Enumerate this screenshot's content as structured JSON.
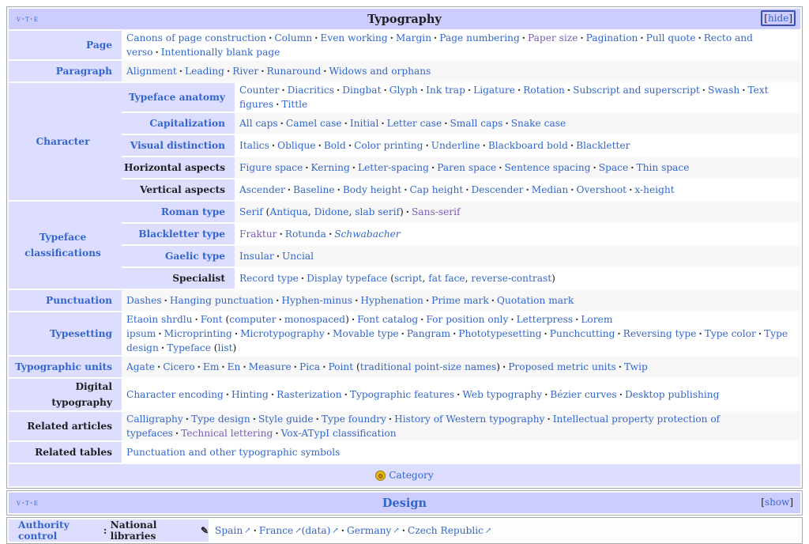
{
  "vte": [
    "v",
    "t",
    "e"
  ],
  "typography": {
    "title": "Typography",
    "toggle": "hide",
    "groups": [
      {
        "id": "page",
        "label": "Page",
        "label_link": true,
        "rowspan": 1,
        "items": [
          {
            "t": "Canons of page construction"
          },
          {
            "t": "Column"
          },
          {
            "t": "Even working"
          },
          {
            "t": "Margin"
          },
          {
            "t": "Page numbering"
          },
          {
            "t": "Paper size",
            "visited": true
          },
          {
            "t": "Pagination"
          },
          {
            "t": "Pull quote"
          },
          {
            "t": "Recto and verso"
          },
          {
            "t": "Intentionally blank page"
          }
        ]
      },
      {
        "id": "paragraph",
        "label": "Paragraph",
        "label_link": true,
        "items": [
          {
            "t": "Alignment"
          },
          {
            "t": "Leading"
          },
          {
            "t": "River"
          },
          {
            "t": "Runaround"
          },
          {
            "t": "Widows and orphans"
          }
        ]
      },
      {
        "id": "character",
        "label": "Character",
        "label_link": true,
        "subgroups": [
          {
            "label": "Typeface anatomy",
            "label_link": true,
            "items": [
              {
                "t": "Counter"
              },
              {
                "t": "Diacritics"
              },
              {
                "t": "Dingbat"
              },
              {
                "t": "Glyph"
              },
              {
                "t": "Ink trap"
              },
              {
                "t": "Ligature"
              },
              {
                "t": "Rotation"
              },
              {
                "t": "Subscript and superscript"
              },
              {
                "t": "Swash"
              },
              {
                "t": "Text figures"
              },
              {
                "t": "Tittle"
              }
            ]
          },
          {
            "label": "Capitalization",
            "label_link": true,
            "items": [
              {
                "t": "All caps"
              },
              {
                "t": "Camel case"
              },
              {
                "t": "Initial"
              },
              {
                "t": "Letter case"
              },
              {
                "t": "Small caps"
              },
              {
                "t": "Snake case"
              }
            ]
          },
          {
            "label": "Visual distinction",
            "label_link": true,
            "items": [
              {
                "t": "Italics"
              },
              {
                "t": "Oblique"
              },
              {
                "t": "Bold"
              },
              {
                "t": "Color printing"
              },
              {
                "t": "Underline"
              },
              {
                "t": "Blackboard bold"
              },
              {
                "t": "Blackletter"
              }
            ]
          },
          {
            "label": "Horizontal aspects",
            "label_link": false,
            "items": [
              {
                "t": "Figure space"
              },
              {
                "t": "Kerning"
              },
              {
                "t": "Letter-spacing"
              },
              {
                "t": "Paren space"
              },
              {
                "t": "Sentence spacing"
              },
              {
                "t": "Space"
              },
              {
                "t": "Thin space"
              }
            ]
          },
          {
            "label": "Vertical aspects",
            "label_link": false,
            "items": [
              {
                "t": "Ascender"
              },
              {
                "t": "Baseline"
              },
              {
                "t": "Body height"
              },
              {
                "t": "Cap height"
              },
              {
                "t": "Descender"
              },
              {
                "t": "Median"
              },
              {
                "t": "Overshoot"
              },
              {
                "t": "x-height"
              }
            ]
          }
        ]
      },
      {
        "id": "classifications",
        "label": "Typeface classifications",
        "label_link": true,
        "subgroups": [
          {
            "label": "Roman type",
            "label_link": true,
            "rich": [
              {
                "t": "Serif"
              },
              {
                "p": " ("
              },
              {
                "t": "Antiqua"
              },
              {
                "p": ", "
              },
              {
                "t": "Didone"
              },
              {
                "p": ", "
              },
              {
                "t": "slab serif"
              },
              {
                "p": ")"
              },
              {
                "s": 1
              },
              {
                "t": "Sans-serif",
                "visited": true
              }
            ]
          },
          {
            "label": "Blackletter type",
            "label_link": true,
            "rich": [
              {
                "t": "Fraktur",
                "visited": true
              },
              {
                "s": 1
              },
              {
                "t": "Rotunda"
              },
              {
                "s": 1
              },
              {
                "t": "Schwabacher",
                "italic": true
              }
            ]
          },
          {
            "label": "Gaelic type",
            "label_link": true,
            "rich": [
              {
                "t": "Insular"
              },
              {
                "s": 1
              },
              {
                "t": "Uncial"
              }
            ]
          },
          {
            "label": "Specialist",
            "label_link": false,
            "rich": [
              {
                "t": "Record type"
              },
              {
                "s": 1
              },
              {
                "t": "Display typeface"
              },
              {
                "p": " ("
              },
              {
                "t": "script"
              },
              {
                "p": ", "
              },
              {
                "t": "fat face"
              },
              {
                "p": ", "
              },
              {
                "t": "reverse-contrast"
              },
              {
                "p": ")"
              }
            ]
          }
        ]
      },
      {
        "id": "punctuation",
        "label": "Punctuation",
        "label_link": true,
        "items": [
          {
            "t": "Dashes"
          },
          {
            "t": "Hanging punctuation"
          },
          {
            "t": "Hyphen-minus"
          },
          {
            "t": "Hyphenation"
          },
          {
            "t": "Prime mark"
          },
          {
            "t": "Quotation mark"
          }
        ]
      },
      {
        "id": "typesetting",
        "label": "Typesetting",
        "label_link": true,
        "rich": [
          {
            "t": "Etaoin shrdlu"
          },
          {
            "s": 1
          },
          {
            "t": "Font"
          },
          {
            "p": " ("
          },
          {
            "t": "computer"
          },
          {
            "s": 1
          },
          {
            "t": "monospaced"
          },
          {
            "p": ")"
          },
          {
            "s": 1
          },
          {
            "t": "Font catalog"
          },
          {
            "s": 1
          },
          {
            "t": "For position only"
          },
          {
            "s": 1
          },
          {
            "t": "Letterpress"
          },
          {
            "s": 1
          },
          {
            "t": "Lorem ipsum"
          },
          {
            "s": 1
          },
          {
            "t": "Microprinting"
          },
          {
            "s": 1
          },
          {
            "t": "Microtypography"
          },
          {
            "s": 1
          },
          {
            "t": "Movable type"
          },
          {
            "s": 1
          },
          {
            "t": "Pangram"
          },
          {
            "s": 1
          },
          {
            "t": "Phototypesetting"
          },
          {
            "s": 1
          },
          {
            "t": "Punchcutting"
          },
          {
            "s": 1
          },
          {
            "t": "Reversing type"
          },
          {
            "s": 1
          },
          {
            "t": "Type color"
          },
          {
            "s": 1
          },
          {
            "t": "Type design"
          },
          {
            "s": 1
          },
          {
            "t": "Typeface"
          },
          {
            "p": " ("
          },
          {
            "t": "list"
          },
          {
            "p": ")"
          }
        ]
      },
      {
        "id": "units",
        "label": "Typographic units",
        "label_link": true,
        "rich": [
          {
            "t": "Agate"
          },
          {
            "s": 1
          },
          {
            "t": "Cicero"
          },
          {
            "s": 1
          },
          {
            "t": "Em"
          },
          {
            "s": 1
          },
          {
            "t": "En"
          },
          {
            "s": 1
          },
          {
            "t": "Measure"
          },
          {
            "s": 1
          },
          {
            "t": "Pica"
          },
          {
            "s": 1
          },
          {
            "t": "Point"
          },
          {
            "p": " ("
          },
          {
            "t": "traditional point-size names"
          },
          {
            "p": ")"
          },
          {
            "s": 1
          },
          {
            "t": "Proposed metric units"
          },
          {
            "s": 1
          },
          {
            "t": "Twip"
          }
        ]
      },
      {
        "id": "digital",
        "label": "Digital typography",
        "label_link": false,
        "items": [
          {
            "t": "Character encoding"
          },
          {
            "t": "Hinting"
          },
          {
            "t": "Rasterization"
          },
          {
            "t": "Typographic features"
          },
          {
            "t": "Web typography"
          },
          {
            "t": "Bézier curves"
          },
          {
            "t": "Desktop publishing"
          }
        ]
      },
      {
        "id": "related-articles",
        "label": "Related articles",
        "label_link": false,
        "items": [
          {
            "t": "Calligraphy"
          },
          {
            "t": "Type design"
          },
          {
            "t": "Style guide"
          },
          {
            "t": "Type foundry"
          },
          {
            "t": "History of Western typography"
          },
          {
            "t": "Intellectual property protection of typefaces"
          },
          {
            "t": "Technical lettering",
            "visited": true
          },
          {
            "t": "Vox-ATypI classification"
          }
        ]
      },
      {
        "id": "related-tables",
        "label": "Related tables",
        "label_link": false,
        "items": [
          {
            "t": "Punctuation and other typographic symbols"
          }
        ]
      }
    ],
    "category_label": "Category",
    "category_icon": "category-icon"
  },
  "design": {
    "title": "Design",
    "toggle": "show"
  },
  "authority": {
    "label_link": "Authority control",
    "colon": ":",
    "label_bold": "National libraries",
    "edit_icon": "pencil-icon",
    "items": [
      {
        "t": "Spain"
      },
      {
        "t": "France"
      },
      {
        "t": "(data)"
      },
      {
        "t": "Germany"
      },
      {
        "t": "Czech Republic"
      }
    ]
  }
}
